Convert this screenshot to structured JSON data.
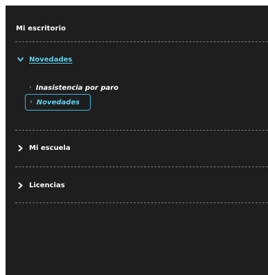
{
  "sidebar": {
    "title": "Mi escritorio",
    "sections": [
      {
        "label": "Novedades",
        "expanded": true,
        "items": [
          {
            "label": "Inasistencia por paro",
            "selected": false
          },
          {
            "label": "Novedades",
            "selected": true
          }
        ]
      },
      {
        "label": "Mi escuela",
        "expanded": false
      },
      {
        "label": "Licencias",
        "expanded": false
      }
    ]
  },
  "colors": {
    "background": "#1e1e1e",
    "accent": "#5fd0f0",
    "focus_border": "#36b7e3",
    "divider": "#7a7a7a"
  },
  "icons": {
    "expanded": "chevron-down-icon",
    "collapsed": "chevron-right-icon",
    "sub": "chevron-right-icon"
  }
}
